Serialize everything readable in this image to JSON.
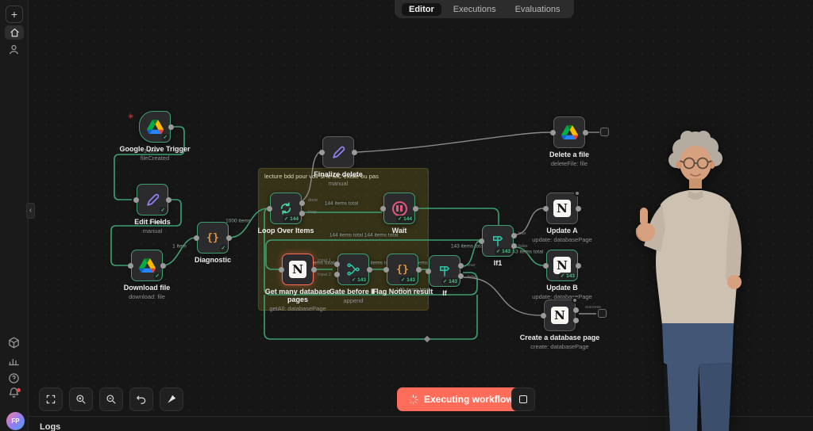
{
  "tabs": [
    {
      "label": "Editor",
      "active": true
    },
    {
      "label": "Executions",
      "active": false
    },
    {
      "label": "Evaluations",
      "active": false
    }
  ],
  "sticky_note": {
    "text": "lecture bdd pour voir si le MC existe ou pas"
  },
  "nodes": [
    {
      "label": "Google Drive Trigger",
      "sublabel": "fileCreated",
      "badge": "✓"
    },
    {
      "label": "Edit Fields",
      "sublabel": "manual",
      "badge": "✓"
    },
    {
      "label": "Download file",
      "sublabel": "download: file",
      "badge": "✓"
    },
    {
      "label": "Diagnostic",
      "sublabel": "",
      "badge": "✓"
    },
    {
      "label": "Loop Over Items",
      "sublabel": "",
      "badge": "✓ 144"
    },
    {
      "label": "Wait",
      "sublabel": "",
      "badge": "✓ 144"
    },
    {
      "label": "Get many database pages",
      "sublabel": "getAll: databasePage",
      "badge": ""
    },
    {
      "label": "Gate before IF",
      "sublabel": "append",
      "badge": "✓ 143"
    },
    {
      "label": "Flag Notion result",
      "sublabel": "",
      "badge": "✓ 143"
    },
    {
      "label": "If",
      "sublabel": "",
      "badge": "✓ 143"
    },
    {
      "label": "If1",
      "sublabel": "",
      "badge": "✓ 143"
    },
    {
      "label": "Update A",
      "sublabel": "update: databasePage",
      "badge": ""
    },
    {
      "label": "Update B",
      "sublabel": "update: databasePage",
      "badge": "✓ 143"
    },
    {
      "label": "Create a database page",
      "sublabel": "create: databasePage",
      "badge": ""
    },
    {
      "label": "Delete a file",
      "sublabel": "deleteFile: file",
      "badge": ""
    },
    {
      "label": "Finalize delete",
      "sublabel": "manual",
      "badge": ""
    }
  ],
  "edge_labels": [
    "1 item",
    "1 item",
    "1 item",
    "1000 items",
    "144 items total",
    "144 items total 144 items total",
    "143 items total",
    "286 items total",
    "143 items total",
    "143 items total",
    "143 items total",
    "143 items total"
  ],
  "port_labels": {
    "loop_done": "done",
    "loop_loop": "loop",
    "gate_in1": "Input 1",
    "gate_in2": "Input 2",
    "if_true": "true",
    "if_false": "false",
    "if1_true": "true",
    "if1_false": "false",
    "create_success": "success"
  },
  "icons": {
    "plus": "+",
    "notion": "N",
    "code": "{}",
    "pinned": "✳",
    "help": "?",
    "collapse": "‹"
  },
  "controls": {
    "executing": "Executing workflow"
  },
  "logs": {
    "title": "Logs"
  },
  "avatar": {
    "initials": "FP"
  },
  "colors": {
    "accent": "#ff6d5a",
    "success": "#3f9f72",
    "badge_green": "#4cc38a",
    "edge_green": "#3f9f72"
  }
}
